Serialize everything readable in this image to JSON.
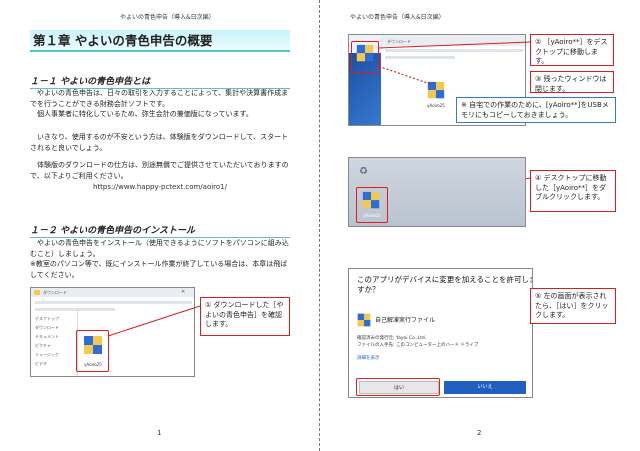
{
  "page1": {
    "header": "やよいの青色申告（導入&日次編）",
    "chapter_title": "第１章 やよいの青色申告の概要",
    "section1_title": "１－１ やよいの青色申告とは",
    "section1_para1": "やよいの青色申告は、日々の取引を入力することによって、集計や決算書作成までを行うことができる財務会計ソフトです。",
    "section1_para2": "個人事業者に特化しているため、弥生会計の兼価版になっています。",
    "section1_para3": "いきなり、使用するのが不安という方は、体験版をダウンロードして、スタートされると良いでしょう。",
    "section1_para4": "体験版のダウンロードの仕方は、別途無償でご提供させていただいておりますので、以下よりご利用ください。",
    "url": "https://www.happy-pctext.com/aoiro1/",
    "section2_title": "１－２ やよいの青色申告のインストール",
    "section2_para1": "やよいの青色申告をインストール（使用できるようにソフトをパソコンに組み込むこと）しましょう。",
    "section2_para2": "※教室のパソコン等で、既にインストール作業が終了している場合は、本章は飛ばしてください。",
    "shot_title": "ダウンロード",
    "shot_nav": [
      "デスクトップ",
      "ダウンロード",
      "ドキュメント",
      "ピクチャ",
      "ミュージック",
      "ビデオ"
    ],
    "shot_file": "yAoiro25",
    "callout1": "① ダウンロードした［やよいの青色申告］を確認します。",
    "page_number": "1"
  },
  "page2": {
    "header": "やよいの青色申告（導入&日次編）",
    "shot1_title": "ダウンロード",
    "shot1_icon_label": "yAoiro25",
    "callout2": "② ［yAoiro**］をデスクトップに移動します。",
    "callout3": "③ 残ったウィンドウは閉じます。",
    "note": "※ 自宅での作業のために、[yAoiro**]をUSBメモリにもコピーしておきましょう。",
    "desktop_icon_label": "yAoiro25",
    "callout4": "④ デスクトップに移動した［yAoiro**］をダブルクリックします。",
    "dialog_title": "このアプリがデバイスに変更を加えることを許可しますか？",
    "dialog_app": "自己解凍実行ファイル",
    "dialog_publisher": "確認済みの発行元: Yayoi Co.,Ltd.",
    "dialog_origin": "ファイルの入手先: このコンピューター上のハード ドライブ",
    "dialog_details": "詳細を表示",
    "dialog_yes": "はい",
    "dialog_no": "いいえ",
    "callout5": "⑤ 左の画面が表示されたら、［はい］をクリックします。",
    "page_number": "2"
  },
  "colors": {
    "accent_cyan": "#58c3d3",
    "callout_red": "#d62020",
    "note_blue": "#2f7cc7",
    "no_button": "#1f5fbf"
  }
}
